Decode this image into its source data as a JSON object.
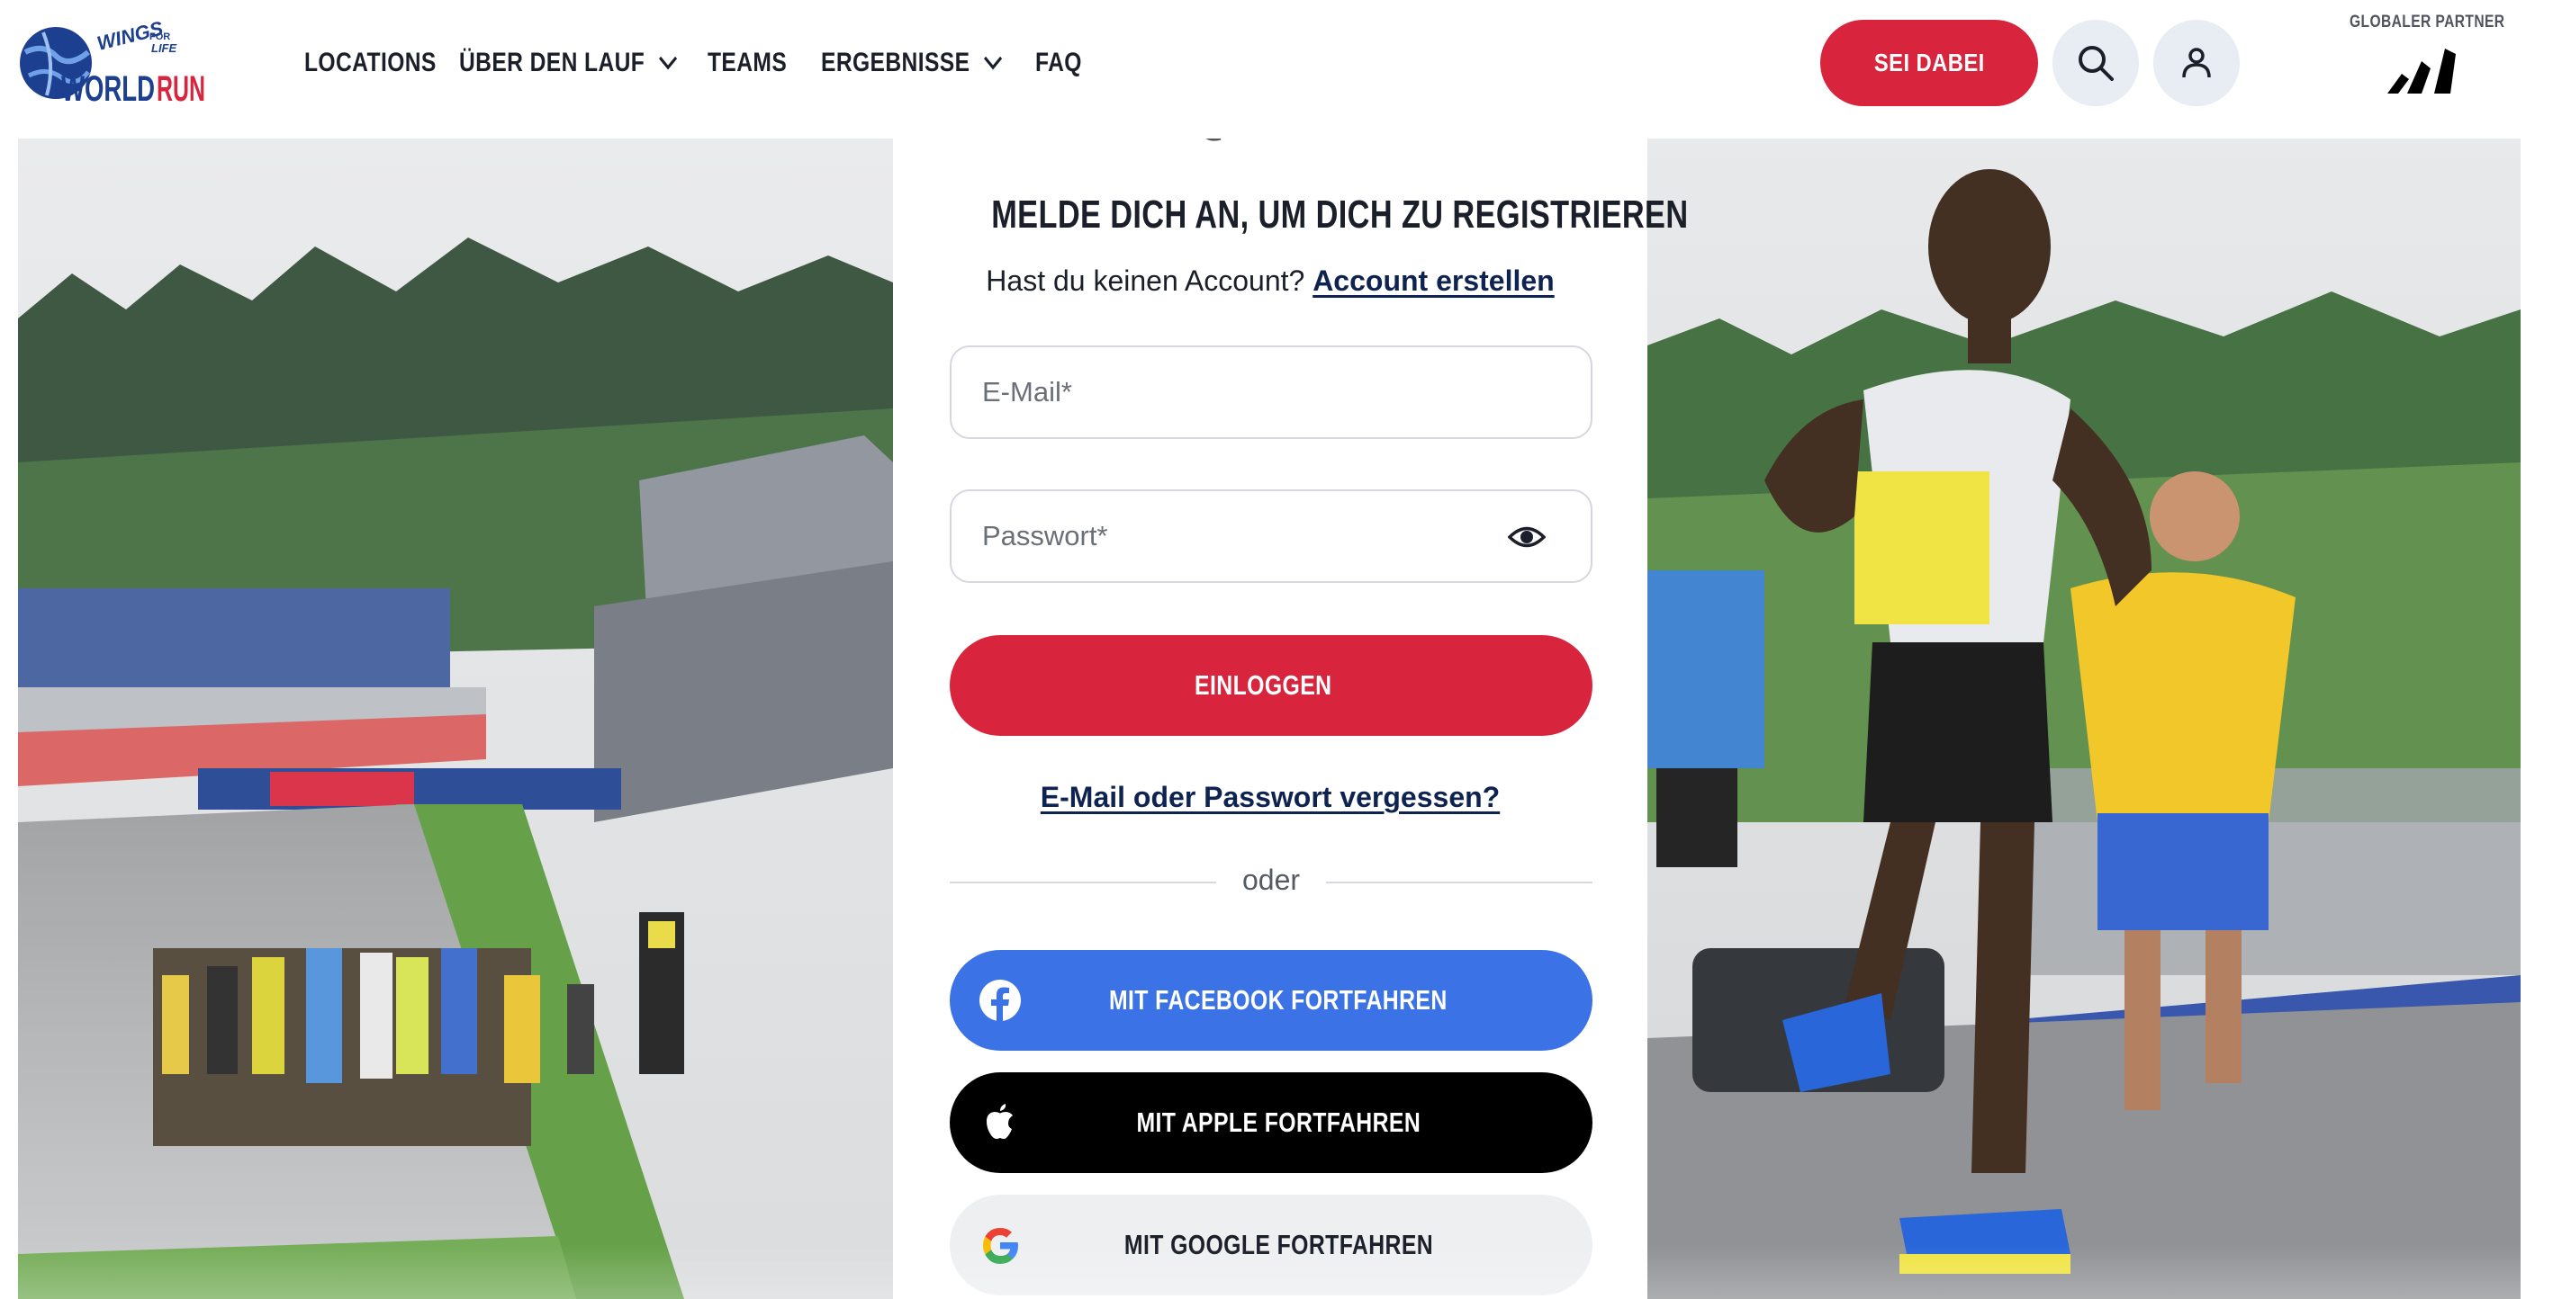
{
  "brand": {
    "logo_top": "WINGS FOR LIFE",
    "logo_bottom_1": "WORLD",
    "logo_bottom_2": "RUN"
  },
  "nav": {
    "items": [
      {
        "label": "LOCATIONS",
        "has_dropdown": false
      },
      {
        "label": "ÜBER DEN LAUF",
        "has_dropdown": true
      },
      {
        "label": "TEAMS",
        "has_dropdown": false
      },
      {
        "label": "ERGEBNISSE",
        "has_dropdown": true
      },
      {
        "label": "FAQ",
        "has_dropdown": false
      }
    ],
    "cta_label": "SEI DABEI",
    "search_icon": "search-icon",
    "account_icon": "user-icon"
  },
  "partner": {
    "label": "GLOBALER PARTNER",
    "logo": "adidas-logo"
  },
  "login": {
    "title": "MELDE DICH AN, UM DICH ZU REGISTRIEREN",
    "no_account_text": "Hast du keinen Account?",
    "create_account_link": "Account erstellen",
    "email_placeholder": "E-Mail*",
    "email_value": "",
    "password_placeholder": "Passwort*",
    "password_value": "",
    "login_button": "EINLOGGEN",
    "forgot_link": "E-Mail oder Passwort vergessen?",
    "divider_text": "oder",
    "facebook_button": "MIT FACEBOOK FORTFAHREN",
    "apple_button": "MIT APPLE FORTFAHREN",
    "google_button": "MIT GOOGLE FORTFAHREN"
  },
  "colors": {
    "accent_red": "#d8243c",
    "navy": "#0f2350",
    "facebook_blue": "#3b72e5",
    "apple_black": "#000000",
    "google_grey": "#eeeff1",
    "icon_button_bg": "#e8ecf3"
  }
}
